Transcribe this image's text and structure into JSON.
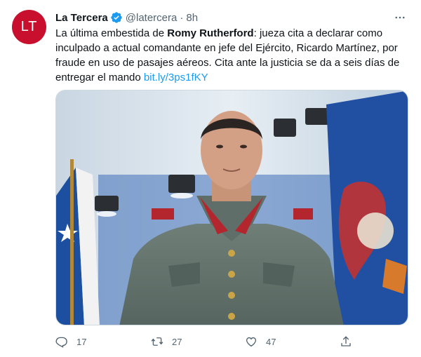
{
  "tweet": {
    "avatar_text": "LT",
    "display_name": "La Tercera",
    "handle": "@latercera",
    "separator": "·",
    "time": "8h",
    "more_label": "···",
    "text_parts": {
      "intro": "La última embestida de ",
      "bold": "Romy Rutherford",
      "rest": ": jueza cita a declarar como inculpado a actual comandante en jefe del Ejército, Ricardo Martínez, por fraude en uso de pasajes aéreos. Cita ante la justicia se da a seis días de entregar el mando ",
      "link": "bit.ly/3ps1fKY"
    },
    "metrics": {
      "replies": "17",
      "retweets": "27",
      "likes": "47"
    },
    "colors": {
      "accent": "#1d9bf0",
      "avatar_bg": "#c8102e",
      "muted": "#536471"
    },
    "icons": [
      "verified-badge-icon",
      "more-icon",
      "reply-icon",
      "retweet-icon",
      "like-icon",
      "share-icon"
    ]
  }
}
